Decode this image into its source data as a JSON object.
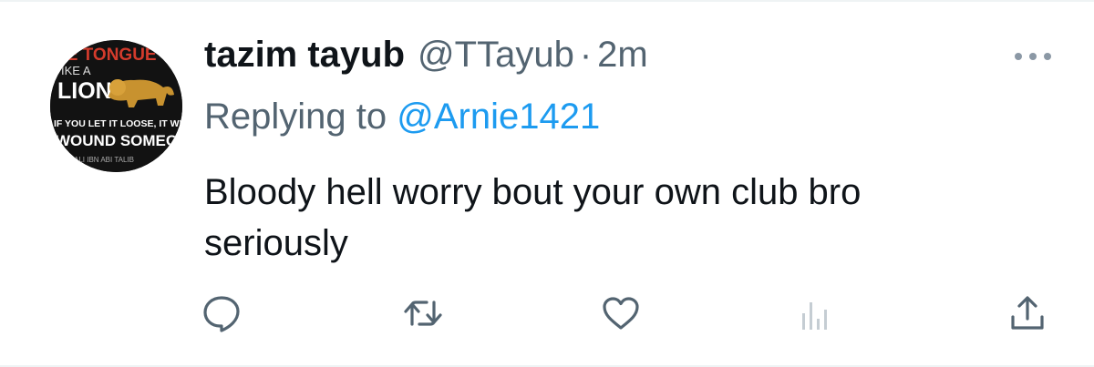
{
  "tweet": {
    "author": {
      "display_name": "tazim tayub",
      "handle": "@TTayub",
      "separator": "·",
      "time": "2m"
    },
    "reply_context": {
      "prefix": "Replying to ",
      "handle": "@Arnie1421"
    },
    "text_lines": [
      "Bloody hell worry bout your own club bro",
      "seriously"
    ],
    "avatar": {
      "image_text": {
        "line1": "HE TONGUE",
        "line2": "IKE A",
        "line3": "LION",
        "line4": "IF YOU LET IT LOOSE, IT WILL",
        "line5": "WOUND SOMEONE",
        "line6": "ALI IBN ABI TALIB"
      }
    }
  },
  "actions": [
    {
      "name": "reply",
      "icon": "reply-icon"
    },
    {
      "name": "retweet",
      "icon": "retweet-icon"
    },
    {
      "name": "like",
      "icon": "heart-icon"
    },
    {
      "name": "views",
      "icon": "analytics-icon"
    },
    {
      "name": "share",
      "icon": "share-icon"
    }
  ],
  "colors": {
    "text_primary": "#0f1419",
    "text_secondary": "#536471",
    "accent": "#1d9bf0",
    "views_icon": "#c5cdd3",
    "avatar_red": "#d33b2c",
    "avatar_gold": "#c8922f"
  }
}
